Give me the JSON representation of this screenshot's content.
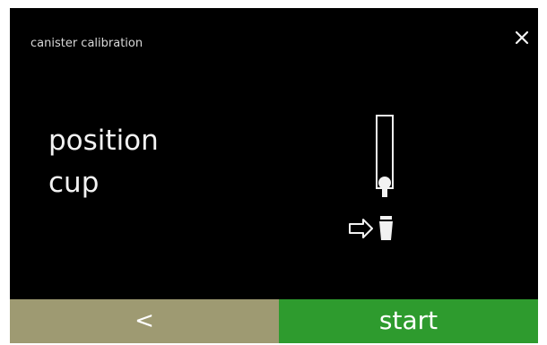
{
  "screen": {
    "title": "canister calibration",
    "close_icon": "close-icon"
  },
  "instruction": {
    "line1": "position",
    "line2": "cup"
  },
  "illustration": {
    "icons": [
      "canister-icon",
      "cup-icon",
      "arrow-right-icon"
    ]
  },
  "buttons": {
    "back_label": "<",
    "start_label": "start"
  },
  "colors": {
    "screen_background": "#000000",
    "back_button": "#9e9a72",
    "start_button": "#2e9b2e",
    "text": "#ffffff"
  }
}
